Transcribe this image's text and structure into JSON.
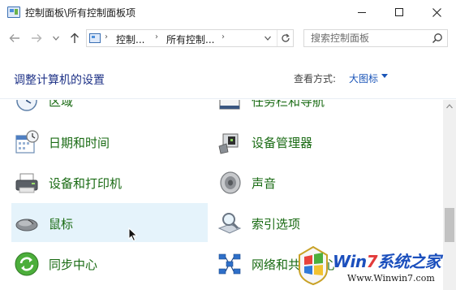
{
  "window": {
    "title": "控制面板\\所有控制面板项",
    "icon": "control-panel-icon"
  },
  "nav": {
    "back_icon": "arrow-left-icon",
    "forward_icon": "arrow-right-icon",
    "history_icon": "chevron-down-icon",
    "up_icon": "arrow-up-icon"
  },
  "address": {
    "crumbs": [
      "控制...",
      "所有控制..."
    ],
    "separator": "›"
  },
  "search": {
    "placeholder": "搜索控制面板"
  },
  "header": {
    "title": "调整计算机的设置",
    "view_label": "查看方式:",
    "view_value": "大图标"
  },
  "items": [
    {
      "label": "区域",
      "icon": "region-clock-icon"
    },
    {
      "label": "任务栏和导航",
      "icon": "taskbar-icon"
    },
    {
      "label": "日期和时间",
      "icon": "calendar-clock-icon"
    },
    {
      "label": "设备管理器",
      "icon": "device-manager-icon"
    },
    {
      "label": "设备和打印机",
      "icon": "printer-icon"
    },
    {
      "label": "声音",
      "icon": "speaker-icon"
    },
    {
      "label": "鼠标",
      "icon": "mouse-icon"
    },
    {
      "label": "索引选项",
      "icon": "index-search-icon"
    },
    {
      "label": "同步中心",
      "icon": "sync-icon"
    },
    {
      "label": "网络和共享中心",
      "icon": "network-icon"
    }
  ],
  "watermark": {
    "brand_prefix": "Win",
    "brand_seven": "7",
    "brand_suffix": "系统之家",
    "url": "Www.Winwin7.com"
  },
  "colors": {
    "title_blue": "#1e3287",
    "link_blue": "#1a55b8",
    "item_green": "#1a6b14",
    "hover_bg": "#e5f3fb"
  }
}
